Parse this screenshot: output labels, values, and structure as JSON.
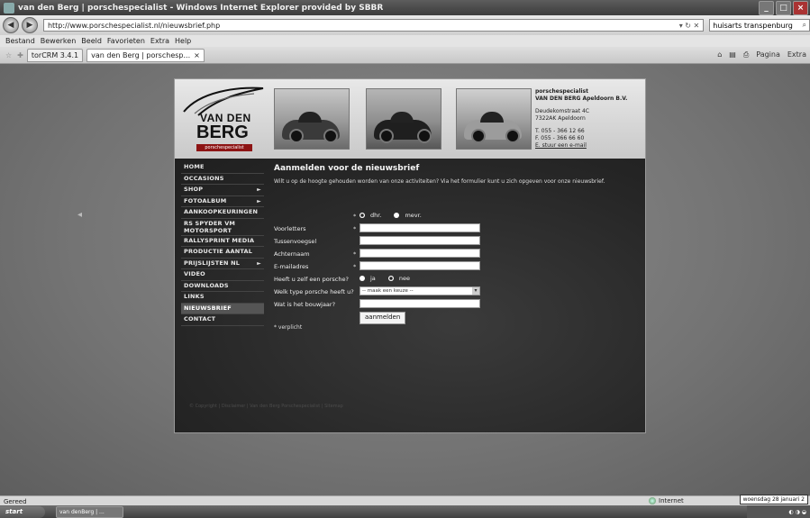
{
  "window": {
    "title": "van den Berg | porschespecialist - Windows Internet Explorer provided by SBBR",
    "minimize": "_",
    "maximize": "□",
    "close": "×"
  },
  "address_bar": {
    "url": "http://www.porschespecialist.nl/nieuwsbrief.php",
    "url_tools": "▾ ↻ ✕",
    "search_value": "huisarts transpenburg"
  },
  "menu": [
    "Bestand",
    "Bewerken",
    "Beeld",
    "Favorieten",
    "Extra",
    "Help"
  ],
  "tabs": [
    {
      "label": "torCRM 3.4.1"
    },
    {
      "label": "van den Berg | porschesp..."
    }
  ],
  "toolbar_right": {
    "home": "⌂",
    "feeds": "▤",
    "print": "⎙",
    "page": "Pagina",
    "extra": "Extra"
  },
  "site": {
    "logo": {
      "line1": "VAN DEN",
      "line2": "BERG",
      "sub": "porschespecialist"
    },
    "address": {
      "line1": "porschespecialist",
      "line2": "VAN DEN BERG Apeldoorn B.V.",
      "street": "Deudekomstraat 4C",
      "city": "7322AK Apeldoorn",
      "phone": "T. 055 - 366 12 66",
      "fax": "F. 055 - 366 66 60",
      "email": "E. stuur een e-mail"
    },
    "sidebar": [
      {
        "label": "HOME",
        "arrow": ""
      },
      {
        "label": "OCCASIONS",
        "arrow": ""
      },
      {
        "label": "SHOP",
        "arrow": "►"
      },
      {
        "label": "FOTOALBUM",
        "arrow": "►"
      },
      {
        "label": "AANKOOPKEURINGEN",
        "arrow": ""
      },
      {
        "label": "RS SPYDER VM MOTORSPORT",
        "arrow": ""
      },
      {
        "label": "RALLYSPRINT MEDIA",
        "arrow": ""
      },
      {
        "label": "PRODUCTIE AANTAL",
        "arrow": ""
      },
      {
        "label": "PRIJSLIJSTEN NL",
        "arrow": "►"
      },
      {
        "label": "VIDEO",
        "arrow": ""
      },
      {
        "label": "DOWNLOADS",
        "arrow": ""
      },
      {
        "label": "LINKS",
        "arrow": ""
      },
      {
        "label": "NIEUWSBRIEF",
        "arrow": ""
      },
      {
        "label": "CONTACT",
        "arrow": ""
      }
    ],
    "content": {
      "heading": "Aanmelden voor de nieuwsbrief",
      "intro": "Wilt u op de hoogte gehouden worden van onze activiteiten? Via het formulier kunt u zich opgeven voor onze nieuwsbrief.",
      "salutation": {
        "required": "*",
        "option1": "dhr.",
        "option2": "mevr."
      },
      "fields": {
        "voorletters": {
          "label": "Voorletters",
          "required": "*",
          "value": ""
        },
        "tussenvoegsel": {
          "label": "Tussenvoegsel",
          "required": "",
          "value": ""
        },
        "achternaam": {
          "label": "Achternaam",
          "required": "*",
          "value": ""
        },
        "email": {
          "label": "E-mailadres",
          "required": "*",
          "value": ""
        }
      },
      "owns_porsche": {
        "label": "Heeft u zelf een porsche?",
        "option_yes": "ja",
        "option_no": "nee"
      },
      "porsche_type": {
        "label": "Welk type porsche heeft u?",
        "selected": "-- maak een keuze --"
      },
      "bouwjaar": {
        "label": "Wat is het bouwjaar?",
        "value": ""
      },
      "submit": "aanmelden",
      "required_note": "* verplicht"
    },
    "footer": "© Copyright   |   Disclaimer   |   Van den Berg Porschespecialist   |   Sitemap"
  },
  "status_bar": {
    "status": "Gereed",
    "zone": "Internet"
  },
  "taskbar": {
    "start": "start",
    "tasks": [
      "van denBerg | ..."
    ],
    "clock_popup": "woensdag 28 januari 2"
  }
}
